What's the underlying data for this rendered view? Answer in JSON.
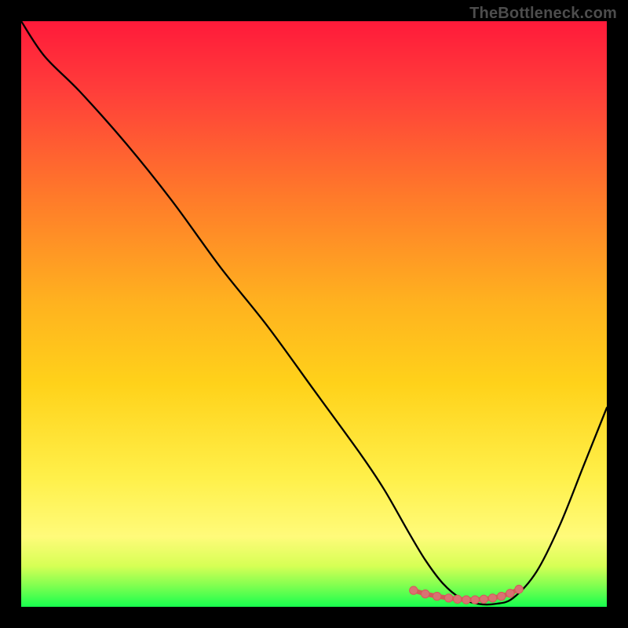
{
  "attribution": "TheBottleneck.com",
  "colors": {
    "background": "#000000",
    "attribution_text": "#4d4d4d",
    "gradient_top": "#ff1a3a",
    "gradient_upper": "#ff7a2a",
    "gradient_mid": "#ffd21a",
    "gradient_lower": "#fff55a",
    "gradient_bottom": "#17ff4e",
    "curve_stroke": "#000000",
    "marker_stroke": "#d55a5a",
    "marker_fill": "#d97272"
  },
  "chart_data": {
    "type": "line",
    "title": "",
    "xlabel": "",
    "ylabel": "",
    "xlim": [
      0,
      100
    ],
    "ylim": [
      0,
      100
    ],
    "legend": null,
    "grid": false,
    "annotations": [],
    "series": [
      {
        "name": "bottleneck-curve",
        "x": [
          0,
          4,
          10,
          18,
          26,
          34,
          42,
          50,
          58,
          62,
          66,
          69,
          72,
          75,
          78,
          81,
          84,
          88,
          92,
          96,
          100
        ],
        "y": [
          100,
          94,
          88,
          79,
          69,
          58,
          48,
          37,
          26,
          20,
          13,
          8,
          4,
          1.5,
          0.5,
          0.5,
          1.5,
          6,
          14,
          24,
          34
        ]
      }
    ],
    "markers": {
      "name": "flat-valley-markers",
      "x": [
        67,
        69,
        71,
        73,
        74.5,
        76,
        77.5,
        79,
        80.5,
        82,
        83.5,
        85
      ],
      "y": [
        2.8,
        2.2,
        1.8,
        1.5,
        1.3,
        1.2,
        1.2,
        1.3,
        1.5,
        1.8,
        2.3,
        3.0
      ]
    },
    "description": "Vertical rainbow gradient background (red at top through orange/yellow to green at bottom) with a black V-shaped bottleneck curve; pink dotted markers mark the flat bottom of the valley near x≈67–85."
  }
}
